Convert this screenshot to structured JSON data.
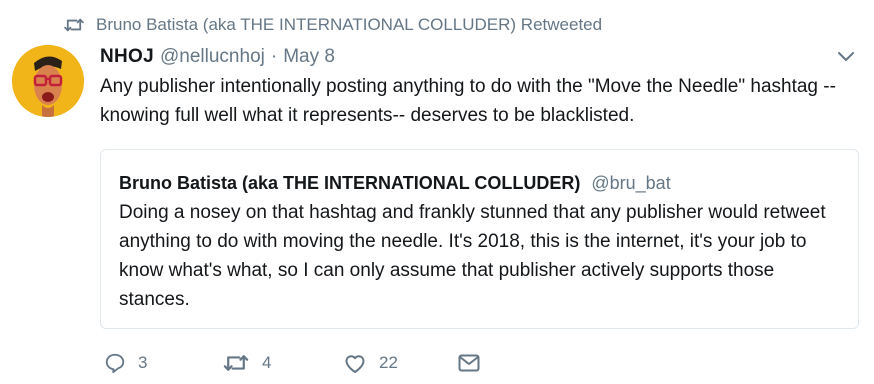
{
  "retweet_context": {
    "text": "Bruno Batista (aka THE INTERNATIONAL COLLUDER) Retweeted",
    "icon": "retweet-icon"
  },
  "tweet": {
    "display_name": "NHOJ",
    "handle": "@nellucnhoj",
    "separator": "·",
    "date": "May 8",
    "text": "Any publisher intentionally posting anything to do with the \"Move the Needle\" hashtag --knowing full well what it represents-- deserves to be blacklisted.",
    "menu_icon": "chevron-down-icon"
  },
  "quoted_tweet": {
    "display_name": "Bruno Batista (aka THE INTERNATIONAL COLLUDER)",
    "handle": "@bru_bat",
    "text": "Doing a nosey on that hashtag and frankly stunned that any publisher would retweet anything to do with moving the needle. It's 2018, this is the internet, it's your job to know what's what, so I can only assume that publisher actively supports those stances."
  },
  "actions": {
    "reply_count": "3",
    "retweet_count": "4",
    "like_count": "22"
  },
  "colors": {
    "secondary_text": "#657786",
    "primary_text": "#14171a",
    "card_border": "#e1e8ed",
    "avatar_bg": "#f2b519"
  }
}
